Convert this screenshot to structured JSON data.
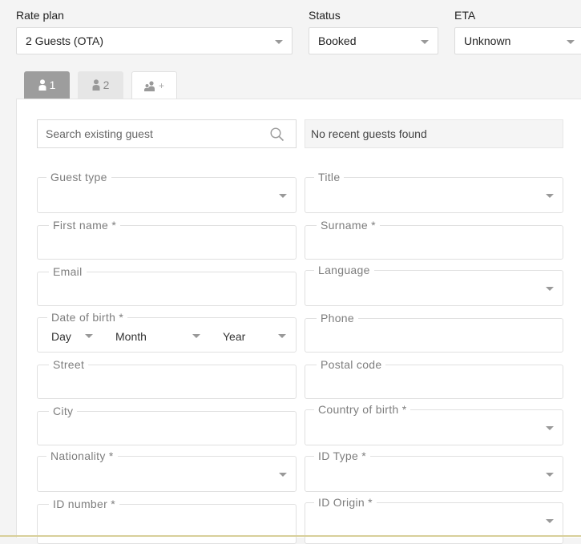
{
  "header": {
    "rate_plan_label": "Rate plan",
    "rate_plan_value": "2 Guests (OTA)",
    "status_label": "Status",
    "status_value": "Booked",
    "eta_label": "ETA",
    "eta_value": "Unknown"
  },
  "tabs": [
    {
      "label": "1",
      "icon": "person-icon",
      "active": true
    },
    {
      "label": "2",
      "icon": "person-icon",
      "active": false
    },
    {
      "label": "+",
      "icon": "add-person-icon",
      "active": false
    }
  ],
  "search": {
    "placeholder": "Search existing guest",
    "recent_message": "No recent guests found"
  },
  "form": {
    "guest_type": "Guest type",
    "title": "Title",
    "first_name": "First name *",
    "surname": "Surname *",
    "email": "Email",
    "language": "Language",
    "date_of_birth": "Date of birth *",
    "dob_day": "Day",
    "dob_month": "Month",
    "dob_year": "Year",
    "phone": "Phone",
    "street": "Street",
    "postal_code": "Postal code",
    "city": "City",
    "country_of_birth": "Country of birth *",
    "nationality": "Nationality *",
    "id_type": "ID Type *",
    "id_number": "ID number *",
    "id_origin": "ID Origin *"
  },
  "colors": {
    "active_tab": "#9d9d9d",
    "border": "#e0e0e0",
    "label": "#7d7d7d"
  }
}
